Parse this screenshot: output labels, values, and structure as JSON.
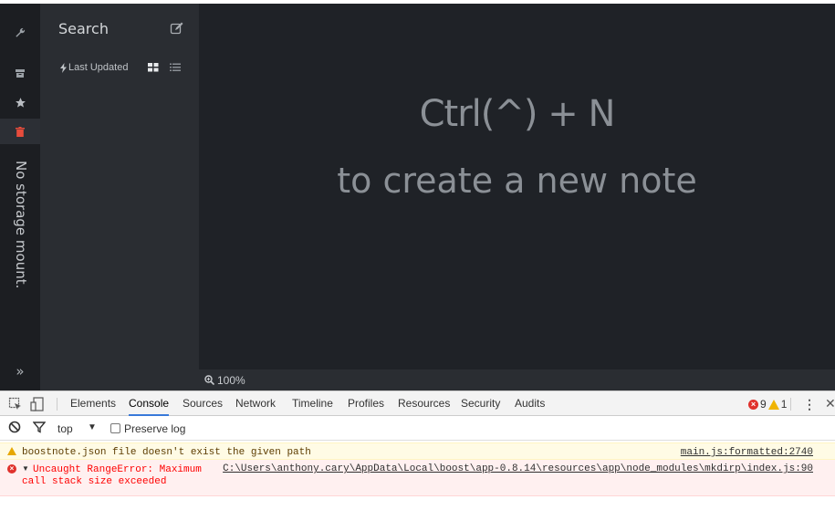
{
  "sidenav": {
    "storage_label": "No storage mount.",
    "expand_glyph": "»",
    "icons": [
      "wrench-icon",
      "archive-icon",
      "star-icon",
      "trash-icon",
      "double-chevron-right-icon"
    ]
  },
  "notelist": {
    "title": "Search",
    "sort_label": "Last Updated"
  },
  "main": {
    "hint_line1": "Ctrl(^) + N",
    "hint_line2": "to create a new note"
  },
  "statusbar": {
    "zoom": "100%"
  },
  "devtools": {
    "tabs": [
      "Elements",
      "Console",
      "Sources",
      "Network",
      "Timeline",
      "Profiles",
      "Resources",
      "Security",
      "Audits"
    ],
    "active_tab": "Console",
    "error_count": "9",
    "warning_count": "1",
    "context": "top",
    "preserve_log_label": "Preserve log",
    "messages": {
      "warning_text": "boostnote.json file doesn't exist the given path",
      "warning_source": "main.js:formatted:2740",
      "error_text_line1": "Uncaught RangeError: Maximum",
      "error_text_line2": "call stack size exceeded",
      "error_source": "C:\\Users\\anthony.cary\\AppData\\Local\\boost\\app-0.8.14\\resources\\app\\node_modules\\mkdirp\\index.js:90"
    }
  },
  "colors": {
    "app_bg": "#1f2227",
    "sidebar_bg": "#1c1e22",
    "notelist_bg": "#2a2d32",
    "trash_accent": "#e74c3c",
    "devtools_active_tab": "#3879d9",
    "error_red": "#e0312c",
    "warning_yellow": "#f0b400"
  }
}
